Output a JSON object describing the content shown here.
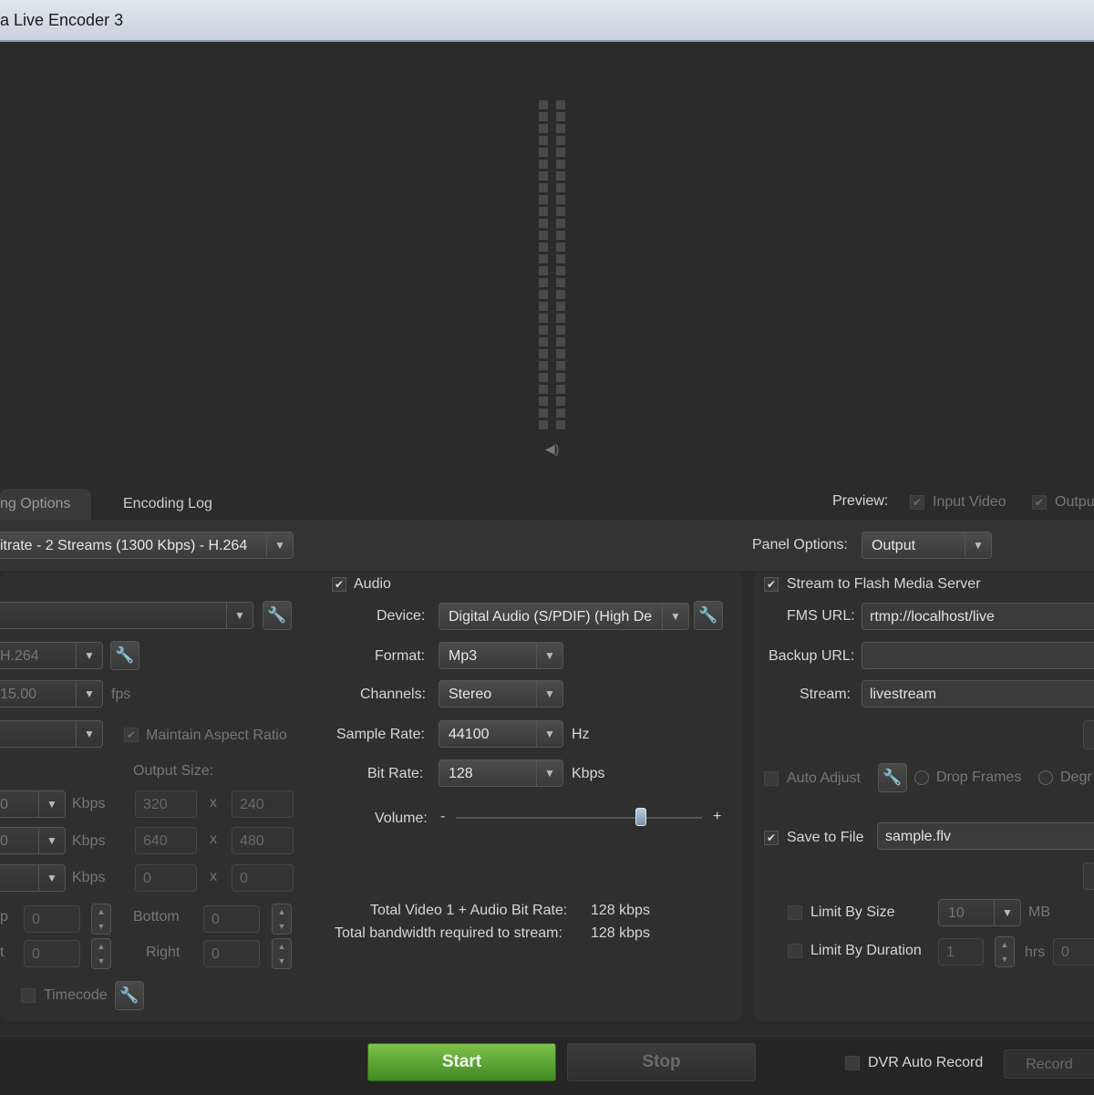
{
  "window": {
    "title": "a Live Encoder 3"
  },
  "tabs": {
    "options": "ng Options",
    "log": "Encoding Log"
  },
  "preview": {
    "label": "Preview:",
    "input_video": "Input Video",
    "output": "Outpu"
  },
  "preset": {
    "value": "itrate - 2 Streams (1300 Kbps) - H.264"
  },
  "panel_options": {
    "label": "Panel Options:",
    "value": "Output"
  },
  "video": {
    "codec": "H.264",
    "frame_rate": "15.00",
    "fps_unit": "fps",
    "maintain_aspect": "Maintain Aspect Ratio",
    "output_size_label": "Output Size:",
    "kbps": "Kbps",
    "x": "x",
    "rows": [
      {
        "bitrate": "0",
        "w": "320",
        "h": "240"
      },
      {
        "bitrate": "0",
        "w": "640",
        "h": "480"
      },
      {
        "bitrate": "",
        "w": "0",
        "h": "0"
      }
    ],
    "crop": {
      "top_label": "p",
      "left_label": "t",
      "bottom_label": "Bottom",
      "right_label": "Right",
      "top": "0",
      "left": "0",
      "bottom": "0",
      "right": "0"
    },
    "timecode": "Timecode"
  },
  "audio": {
    "title": "Audio",
    "device_label": "Device:",
    "device": "Digital Audio (S/PDIF) (High De",
    "format_label": "Format:",
    "format": "Mp3",
    "channels_label": "Channels:",
    "channels": "Stereo",
    "sample_rate_label": "Sample Rate:",
    "sample_rate": "44100",
    "hz": "Hz",
    "bit_rate_label": "Bit Rate:",
    "bit_rate": "128",
    "kbps": "Kbps",
    "volume_label": "Volume:",
    "minus": "-",
    "plus": "+",
    "volume_level": 0.75
  },
  "totals": {
    "total_label": "Total Video 1 + Audio Bit Rate:",
    "total_value": "128 kbps",
    "bandwidth_label": "Total bandwidth required to stream:",
    "bandwidth_value": "128 kbps"
  },
  "output": {
    "stream_fms": "Stream to Flash Media Server",
    "fms_url_label": "FMS URL:",
    "fms_url": "rtmp://localhost/live",
    "backup_url_label": "Backup URL:",
    "backup_url": "",
    "stream_label": "Stream:",
    "stream": "livestream",
    "auto_adjust": "Auto Adjust",
    "drop_frames": "Drop Frames",
    "degrade": "Degr",
    "save_to_file": "Save to File",
    "file": "sample.flv",
    "limit_size": "Limit By Size",
    "size_value": "10",
    "mb": "MB",
    "limit_duration": "Limit By Duration",
    "duration_value": "1",
    "hrs": "hrs",
    "min_value": "0"
  },
  "bottom": {
    "start": "Start",
    "stop": "Stop",
    "dvr": "DVR Auto Record",
    "record": "Record"
  }
}
